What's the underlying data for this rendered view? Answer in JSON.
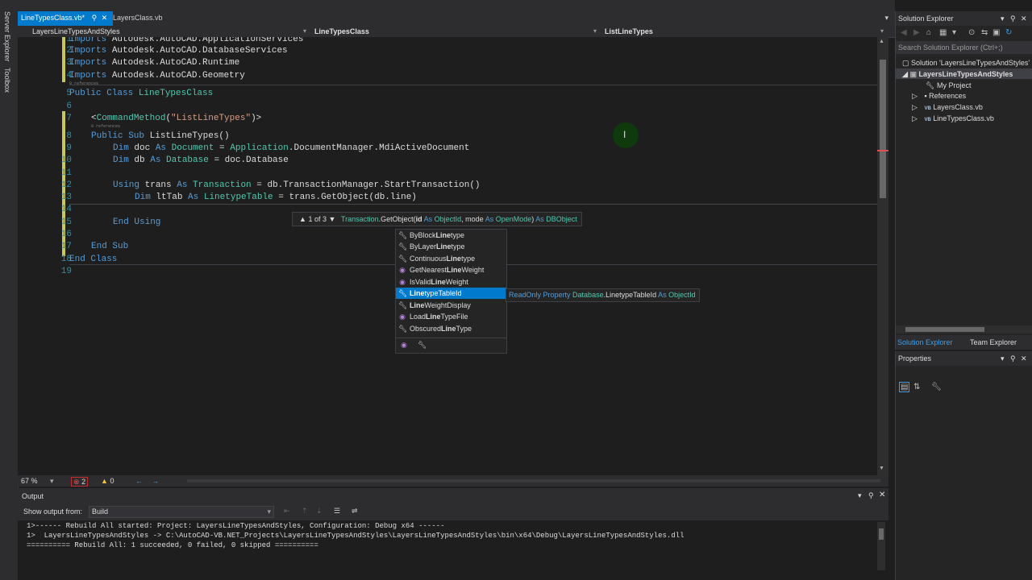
{
  "left_strip": {
    "items": [
      "Server Explorer",
      "Toolbox"
    ]
  },
  "tabs": [
    {
      "label": "LineTypesClass.vb*",
      "active": true
    },
    {
      "label": "LayersClass.vb",
      "active": false
    }
  ],
  "navbar": {
    "project": "LayersLineTypesAndStyles",
    "class": "LineTypesClass",
    "member": "ListLineTypes"
  },
  "code": {
    "line_numbers": [
      "1",
      "2",
      "3",
      "4",
      "5",
      "6",
      "7",
      "8",
      "9",
      "10",
      "11",
      "12",
      "13",
      "14",
      "15",
      "16",
      "17",
      "18",
      "19"
    ],
    "references_label": "0 references",
    "lines": {
      "l1": [
        "Imports",
        " Autodesk.AutoCAD.ApplicationServices"
      ],
      "l2": [
        "Imports",
        " Autodesk.AutoCAD.DatabaseServices"
      ],
      "l3": [
        "Imports",
        " Autodesk.AutoCAD.Runtime"
      ],
      "l4": [
        "Imports",
        " Autodesk.AutoCAD.Geometry"
      ],
      "l5": [
        "Public Class",
        " LineTypesClass"
      ],
      "l7": [
        "<",
        "CommandMethod",
        "(",
        "\"ListLineTypes\"",
        ")>"
      ],
      "l8": [
        "Public Sub",
        " ListLineTypes()"
      ],
      "l9": [
        "Dim",
        " doc ",
        "As",
        " ",
        "Document",
        " = ",
        "Application",
        ".DocumentManager.MdiActiveDocument"
      ],
      "l10": [
        "Dim",
        " db ",
        "As",
        " ",
        "Database",
        " = doc.Database"
      ],
      "l12": [
        "Using",
        " trans ",
        "As",
        " ",
        "Transaction",
        " = db.TransactionManager.StartTransaction()"
      ],
      "l13": [
        "Dim",
        " ltTab ",
        "As",
        " ",
        "LinetypeTable",
        " = trans.GetObject(db.line)"
      ],
      "l15": [
        "End Using"
      ],
      "l17": [
        "End Sub"
      ],
      "l18": [
        "End Class"
      ]
    }
  },
  "param_info": {
    "counter": "1 of 3",
    "type": "Transaction",
    "method": ".GetObject(",
    "p1_name": "id",
    "p1_as": " As ",
    "p1_type": "ObjectId",
    "sep": ", mode",
    "p2_as": " As ",
    "p2_type": "OpenMode",
    "close": ")",
    "ret_as": " As ",
    "ret_type": "DBObject"
  },
  "completion": {
    "items": [
      {
        "pre": "ByBlock",
        "bold": "Line",
        "post": "type",
        "icon": "wrench-icon"
      },
      {
        "pre": "ByLayer",
        "bold": "Line",
        "post": "type",
        "icon": "wrench-icon"
      },
      {
        "pre": "Continuous",
        "bold": "Line",
        "post": "type",
        "icon": "wrench-icon"
      },
      {
        "pre": "GetNearest",
        "bold": "Line",
        "post": "Weight",
        "icon": "method-icon"
      },
      {
        "pre": "IsValid",
        "bold": "Line",
        "post": "Weight",
        "icon": "method-icon"
      },
      {
        "pre": "",
        "bold": "Line",
        "post": "typeTableId",
        "icon": "wrench-icon",
        "selected": true
      },
      {
        "pre": "",
        "bold": "Line",
        "post": "WeightDisplay",
        "icon": "wrench-icon"
      },
      {
        "pre": "Load",
        "bold": "Line",
        "post": "TypeFile",
        "icon": "method-icon"
      },
      {
        "pre": "Obscured",
        "bold": "Line",
        "post": "Type",
        "icon": "wrench-icon"
      }
    ]
  },
  "tooltip": {
    "readonly": "ReadOnly Property ",
    "cls": "Database",
    "member": ".LinetypeTableId",
    "as": " As ",
    "type": "ObjectId"
  },
  "editor_status": {
    "zoom": "67 %",
    "errors": "2",
    "warnings": "0"
  },
  "output": {
    "title": "Output",
    "show_from_label": "Show output from:",
    "source": "Build",
    "lines": [
      "1>------ Rebuild All started: Project: LayersLineTypesAndStyles, Configuration: Debug x64 ------",
      "1>  LayersLineTypesAndStyles -> C:\\AutoCAD-VB.NET_Projects\\LayersLineTypesAndStyles\\LayersLineTypesAndStyles\\bin\\x64\\Debug\\LayersLineTypesAndStyles.dll",
      "========== Rebuild All: 1 succeeded, 0 failed, 0 skipped =========="
    ]
  },
  "solution_explorer": {
    "title": "Solution Explorer",
    "search_placeholder": "Search Solution Explorer (Ctrl+;)",
    "solution": "Solution 'LayersLineTypesAndStyles'",
    "project": "LayersLineTypesAndStyles",
    "items": [
      "My Project",
      "References",
      "LayersClass.vb",
      "LineTypesClass.vb"
    ],
    "bottom_tabs": [
      "Solution Explorer",
      "Team Explorer"
    ]
  },
  "properties": {
    "title": "Properties"
  },
  "colors": {
    "accent": "#007acc",
    "keyword": "#569cd6",
    "type": "#4ec9b0",
    "string": "#d69d85",
    "linenum": "#2b91af"
  }
}
